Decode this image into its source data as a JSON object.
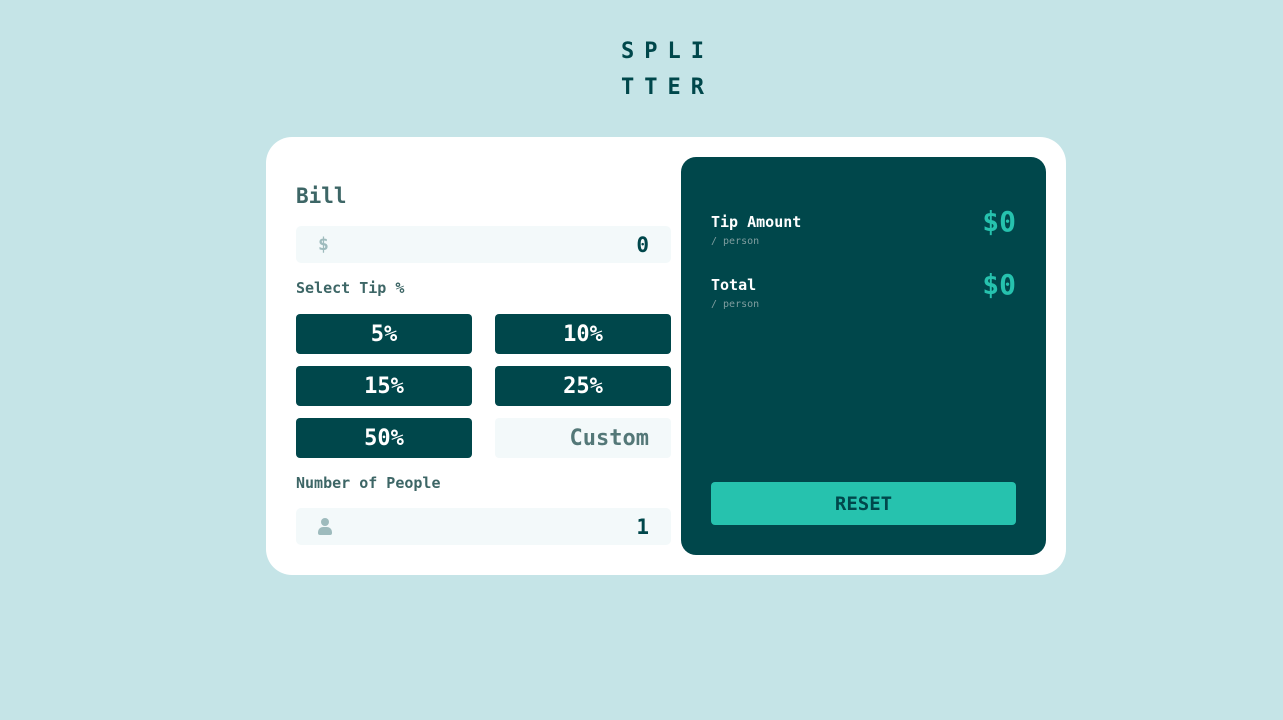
{
  "logo": {
    "line1": "SPLI",
    "line2": "TTER"
  },
  "bill": {
    "label": "Bill",
    "prefix": "$",
    "value": "0"
  },
  "tip": {
    "label": "Select Tip %",
    "options": [
      "5%",
      "10%",
      "15%",
      "25%",
      "50%"
    ],
    "custom_placeholder": "Custom"
  },
  "people": {
    "label": "Number of People",
    "value": "1",
    "icon": "person-icon"
  },
  "results": {
    "tip_amount": {
      "title": "Tip Amount",
      "sub": "/ person",
      "value": "$0"
    },
    "total": {
      "title": "Total",
      "sub": "/ person",
      "value": "$0"
    },
    "reset_label": "RESET"
  },
  "colors": {
    "background": "#c5e4e7",
    "card": "#ffffff",
    "dark_cyan": "#00474b",
    "accent": "#26c2ae",
    "input_bg": "#f3f9fa",
    "label": "#3d6666"
  }
}
